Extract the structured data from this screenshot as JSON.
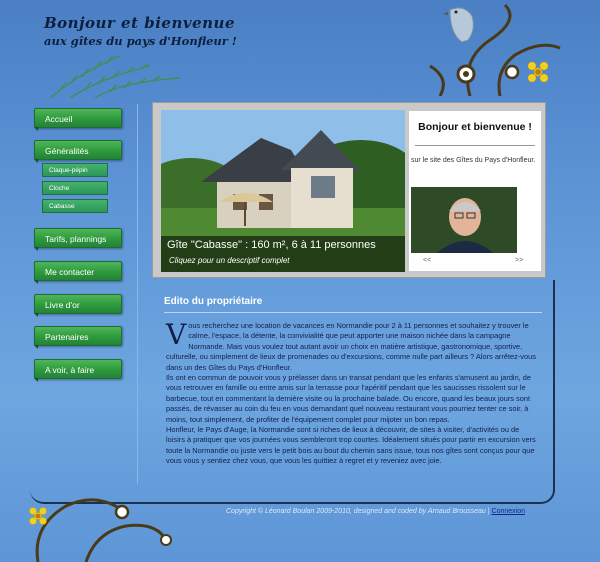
{
  "header": {
    "title_line1": "Bonjour et bienvenue",
    "title_line2": "aux gîtes du pays d'Honfleur !"
  },
  "sidebar": {
    "items": [
      {
        "label": "Accueil"
      },
      {
        "label": "Généralités"
      },
      {
        "label": "Tarifs, plannings"
      },
      {
        "label": "Me contacter"
      },
      {
        "label": "Livre d'or"
      },
      {
        "label": "Partenaires"
      },
      {
        "label": "A voir, à faire"
      }
    ],
    "subitems": [
      {
        "label": "Claque-pépin"
      },
      {
        "label": "Cloche"
      },
      {
        "label": "Cabasse"
      }
    ]
  },
  "slideshow": {
    "caption_line1": "Gîte \"Cabasse\" : 160 m², 6 à 11 personnes",
    "caption_line2": "Cliquez pour un descriptif complet"
  },
  "welcome": {
    "title": "Bonjour et bienvenue !",
    "text": "sur le site des Gîtes du Pays d'Honfleur.",
    "prev": "<<",
    "next": ">>"
  },
  "main": {
    "title": "Edito du propriétaire",
    "dropcap": "V",
    "paragraph1": "ous recherchez une location de vacances en Normandie pour 2 à 11 personnes et souhaitez y trouver le calme, l'espace, la détente, la convivialité que peut apporter une maison nichée dans la campagne Normande. Mais vous voulez tout autant avoir un choix en matière artistique, gastronomique, sportive, culturelle, ou simplement de lieux de promenades ou d'excursions, comme nulle part ailleurs ? Alors arrêtez-vous dans un des Gîtes du Pays d'Honfleur.",
    "paragraph2": "Ils ont en commun de pouvoir vous y prélasser dans un transat pendant que les enfants s'amusent au jardin, de vous retrouver en famille ou entre amis sur la terrasse pour l'apéritif pendant que les saucisses rissolent sur le barbecue, tout en commentant la dernière visite ou la prochaine balade. Ou encore, quand les beaux jours sont passés, de révasser au coin du feu en vous demandant quel nouveau restaurant vous pourriez tenter ce soir, à moins, tout simplement, de profiter de l'équipement complet pour mijoter un bon repas.",
    "paragraph3": "Honfleur, le Pays d'Auge, la Normandie sont si riches de lieux à découvrir, de sites à visiter, d'activités ou de loisirs à pratiquer que vos journées vous sembleront trop courtes. Idéalement situés pour partir en excursion vers toute la Normandie ou juste vers le petit bois au bout du chemin sans issue, tous nos gîtes sont conçus pour que vous vous y sentiez chez vous, que vous les quittiez à regret et y reveniez avec joie."
  },
  "footer": {
    "copyright": "Copyright © Léonard Boulan 2009-2010, designed and coded by Arnaud Brousseau |",
    "login": "Connexion"
  },
  "colors": {
    "nav_green": "#2e9a3c",
    "background_blue": "#5b92d4",
    "title_navy": "#0e1e3e"
  }
}
